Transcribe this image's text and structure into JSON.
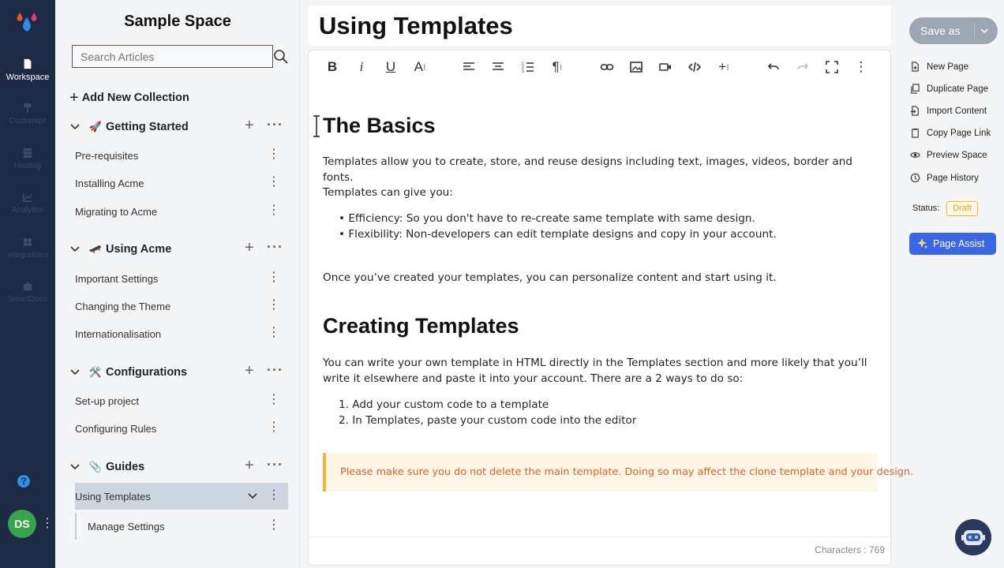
{
  "rail": {
    "items": [
      {
        "label": "Workspace",
        "icon": "file-icon"
      },
      {
        "label": "Customize",
        "icon": "brush-icon"
      },
      {
        "label": "Hosting",
        "icon": "server-icon"
      },
      {
        "label": "Analytics",
        "icon": "chart-icon"
      },
      {
        "label": "Integrations",
        "icon": "puzzle-icon"
      },
      {
        "label": "SmartDocs",
        "icon": "robot-icon"
      }
    ],
    "help": "?",
    "avatar": "DS"
  },
  "sidebar": {
    "space_title": "Sample Space",
    "search_placeholder": "Search Articles",
    "add_collection": "Add New Collection",
    "collections": [
      {
        "name": "Getting Started",
        "emoji": "🚀",
        "articles": [
          "Pre-requisites",
          "Installing Acme",
          "Migrating to Acme"
        ]
      },
      {
        "name": "Using Acme",
        "emoji": "🛹",
        "articles": [
          "Important Settings",
          "Changing the Theme",
          "Internationalisation"
        ]
      },
      {
        "name": "Configurations",
        "emoji": "🛠️",
        "articles": [
          "Set-up project",
          "Configuring Rules"
        ]
      },
      {
        "name": "Guides",
        "emoji": "📎",
        "articles": [
          "Using Templates",
          "Manage Settings"
        ]
      }
    ]
  },
  "editor": {
    "title": "Using Templates",
    "h1_basics": "The Basics",
    "p1": "Templates allow you to create, store, and reuse designs including text, images, videos, border and fonts.",
    "p2": "Templates can give you:",
    "bullets": [
      "Efficiency: So you don't have to re-create same template with same design.",
      "Flexibility: Non-developers can edit template designs and copy in your account."
    ],
    "p3": "Once you’ve created your templates, you can personalize content and start using it.",
    "h1_creating": "Creating Templates",
    "p4_line1": "You can write your own template in HTML directly in the Templates section and more likely that you’ll",
    "p4_line2": "write it elsewhere and paste it into your account. There are a 2 ways to do so:",
    "steps": [
      "1. Add your custom code to a template",
      "2. In Templates, paste your custom code into the editor"
    ],
    "callout": "Please make sure you do not delete the main template. Doing so may affect the clone template and your design.",
    "char_count": "Characters : 769"
  },
  "right": {
    "save_as": "Save as",
    "actions": [
      {
        "label": "New Page",
        "icon": "new-page-icon"
      },
      {
        "label": "Duplicate Page",
        "icon": "duplicate-icon"
      },
      {
        "label": "Import Content",
        "icon": "import-icon"
      },
      {
        "label": "Copy Page Link",
        "icon": "copy-link-icon"
      },
      {
        "label": "Preview Space",
        "icon": "eye-icon"
      },
      {
        "label": "Page History",
        "icon": "history-icon"
      }
    ],
    "status_label": "Status:",
    "status_value": "Draft",
    "page_assist": "Page Assist"
  },
  "colors": {
    "rail_bg": "#1c2a44",
    "accent_blue": "#3b66e6",
    "draft_orange": "#e7a31c",
    "callout_text": "#e0622a"
  }
}
